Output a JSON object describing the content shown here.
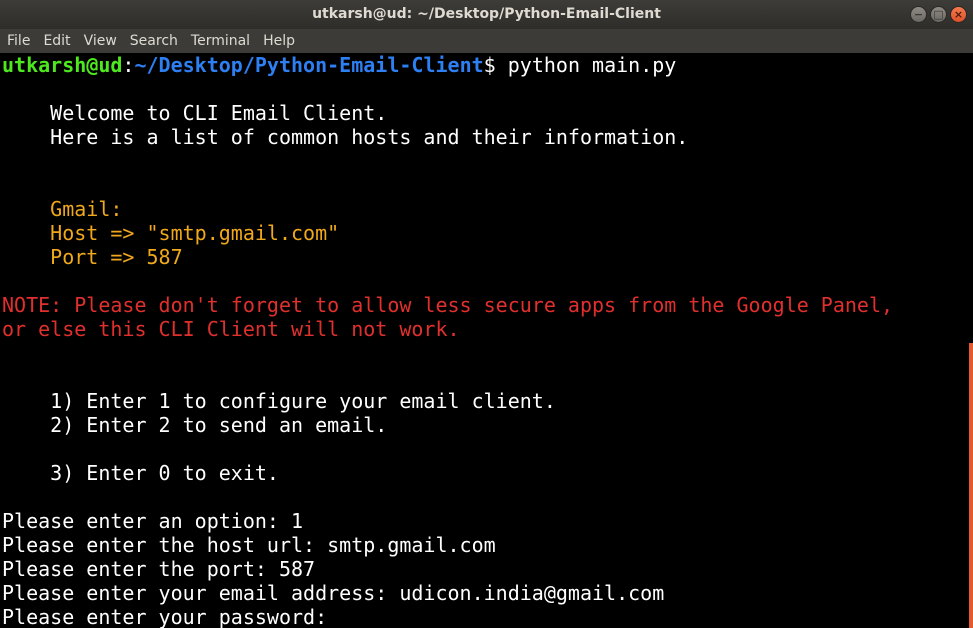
{
  "window": {
    "title": "utkarsh@ud: ~/Desktop/Python-Email-Client",
    "controls": {
      "minimize": "−",
      "maximize": "□",
      "close": "×"
    }
  },
  "menu": {
    "items": [
      {
        "label": "File"
      },
      {
        "label": "Edit"
      },
      {
        "label": "View"
      },
      {
        "label": "Search"
      },
      {
        "label": "Terminal"
      },
      {
        "label": "Help"
      }
    ]
  },
  "terminal": {
    "prompt": {
      "user_host": "utkarsh@ud",
      "sep": ":",
      "path": "~/Desktop/Python-Email-Client",
      "dollar": "$",
      "command": " python main.py"
    },
    "welcome": "    Welcome to CLI Email Client.",
    "hosts_intro": "    Here is a list of common hosts and their information.",
    "gmail_label": "    Gmail:",
    "gmail_host": "    Host => \"smtp.gmail.com\"",
    "gmail_port": "    Port => 587",
    "note_line1": "NOTE: Please don't forget to allow less secure apps from the Google Panel,",
    "note_line2": "or else this CLI Client will not work.",
    "option1": "    1) Enter 1 to configure your email client.",
    "option2": "    2) Enter 2 to send an email.",
    "option3": "    3) Enter 0 to exit.",
    "input_option": "Please enter an option: 1",
    "input_host": "Please enter the host url: smtp.gmail.com",
    "input_port": "Please enter the port: 587",
    "input_email": "Please enter your email address: udicon.india@gmail.com",
    "input_password": "Please enter your password: "
  },
  "colors": {
    "prompt_user": "#4de91c",
    "prompt_path": "#2d7ff2",
    "highlight": "#f0a81c",
    "warning": "#e0302e",
    "scrollbar": "#e65a32"
  }
}
